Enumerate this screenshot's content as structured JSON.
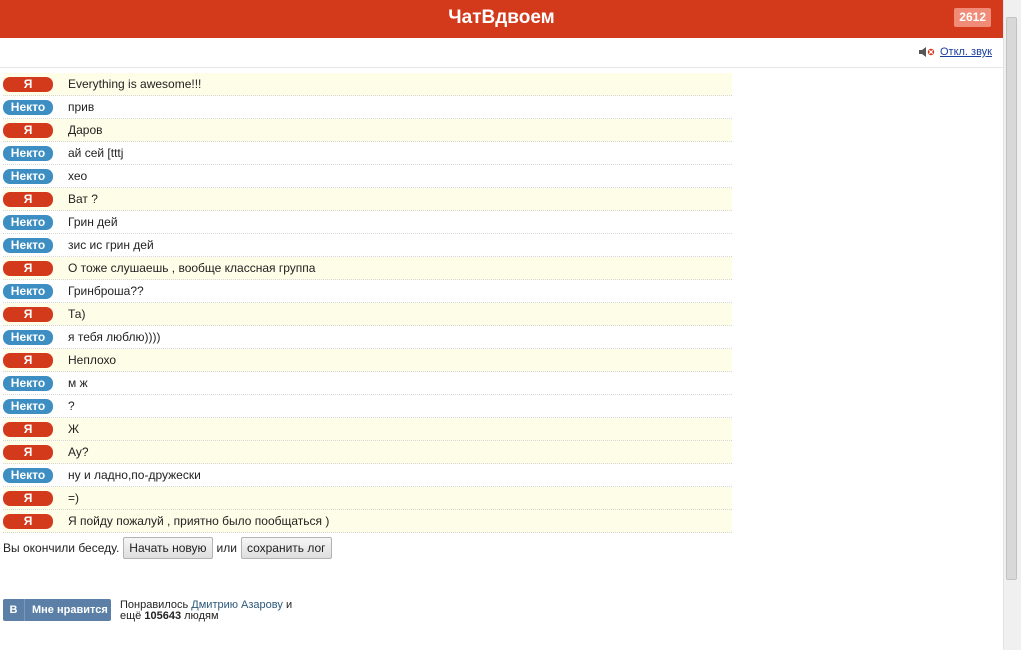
{
  "header": {
    "title": "ЧатВдвоем",
    "online_count": "2612"
  },
  "sound": {
    "label": "Откл. звук"
  },
  "messages": [
    {
      "who": "me",
      "label": "Я",
      "text": "Everything is awesome!!!"
    },
    {
      "who": "stranger",
      "label": "Некто",
      "text": "прив"
    },
    {
      "who": "me",
      "label": "Я",
      "text": "Даров"
    },
    {
      "who": "stranger",
      "label": "Некто",
      "text": "ай сей [tttj"
    },
    {
      "who": "stranger",
      "label": "Некто",
      "text": "хео"
    },
    {
      "who": "me",
      "label": "Я",
      "text": "Ват ?"
    },
    {
      "who": "stranger",
      "label": "Некто",
      "text": "Грин дей"
    },
    {
      "who": "stranger",
      "label": "Некто",
      "text": "зис ис грин дей"
    },
    {
      "who": "me",
      "label": "Я",
      "text": "О тоже слушаешь , вообще классная группа"
    },
    {
      "who": "stranger",
      "label": "Некто",
      "text": "Гринброша??"
    },
    {
      "who": "me",
      "label": "Я",
      "text": "Та)"
    },
    {
      "who": "stranger",
      "label": "Некто",
      "text": "я тебя люблю))))"
    },
    {
      "who": "me",
      "label": "Я",
      "text": "Неплохо"
    },
    {
      "who": "stranger",
      "label": "Некто",
      "text": "м ж"
    },
    {
      "who": "stranger",
      "label": "Некто",
      "text": "?"
    },
    {
      "who": "me",
      "label": "Я",
      "text": "Ж"
    },
    {
      "who": "me",
      "label": "Я",
      "text": "Ау?"
    },
    {
      "who": "stranger",
      "label": "Некто",
      "text": "ну и ладно,по-дружески"
    },
    {
      "who": "me",
      "label": "Я",
      "text": "=)"
    },
    {
      "who": "me",
      "label": "Я",
      "text": "Я пойду пожалуй , приятно было пообщаться )"
    }
  ],
  "end": {
    "text": "Вы окончили беседу.",
    "new_chat_label": "Начать новую",
    "or_text": "или",
    "save_log_label": "сохранить лог"
  },
  "like": {
    "logo": "B",
    "button_label": "Мне нравится",
    "liked_prefix": "Понравилось",
    "friend_name": "Дмитрию Азарову",
    "liked_and": "и",
    "more_prefix": "ещё",
    "count": "105643",
    "people": "людям"
  },
  "colors": {
    "brand": "#d33a1c",
    "me_badge": "#d33a1c",
    "stranger_badge": "#3d8fc3",
    "me_row": "#fefde7",
    "vk": "#5b7fa6"
  }
}
